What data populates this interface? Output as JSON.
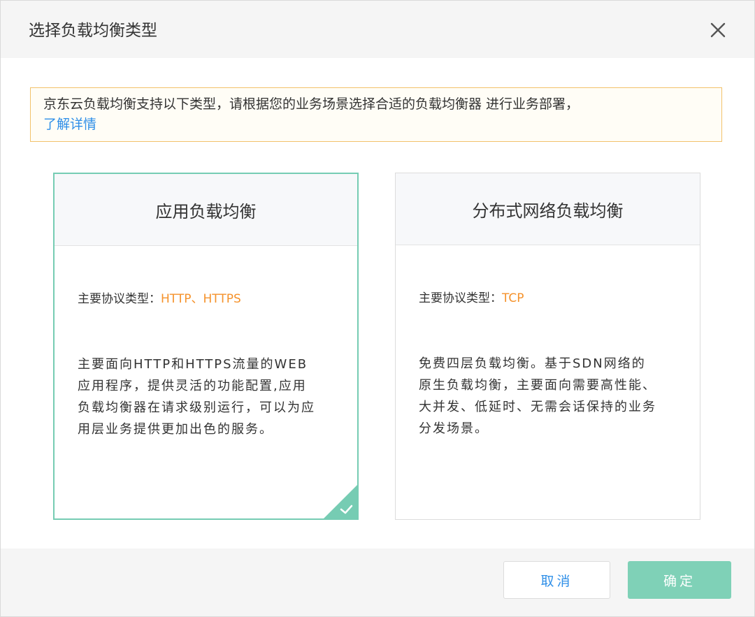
{
  "dialog": {
    "title": "选择负载均衡类型",
    "close_icon": "close-icon"
  },
  "notice": {
    "text": "京东云负载均衡支持以下类型，请根据您的业务场景选择合适的负载均衡器 进行业务部署，",
    "link": "了解详情"
  },
  "cards": [
    {
      "title": "应用负载均衡",
      "protocol_label": "主要协议类型：",
      "protocol_value": "HTTP、HTTPS",
      "description": "主要面向HTTP和HTTPS流量的WEB应用程序，提供灵活的功能配置,应用负载均衡器在请求级别运行，可以为应用层业务提供更加出色的服务。",
      "selected": true
    },
    {
      "title": "分布式网络负载均衡",
      "protocol_label": "主要协议类型：",
      "protocol_value": "TCP",
      "description": "免费四层负载均衡。基于SDN网络的原生负载均衡，主要面向需要高性能、大并发、低延时、无需会话保持的业务分发场景。",
      "selected": false
    }
  ],
  "footer": {
    "cancel_label": "取消",
    "ok_label": "确定"
  },
  "colors": {
    "accent": "#76ccb3",
    "link": "#2f8fe8",
    "protocol_value": "#f5922b",
    "notice_border": "#f2c26b"
  }
}
